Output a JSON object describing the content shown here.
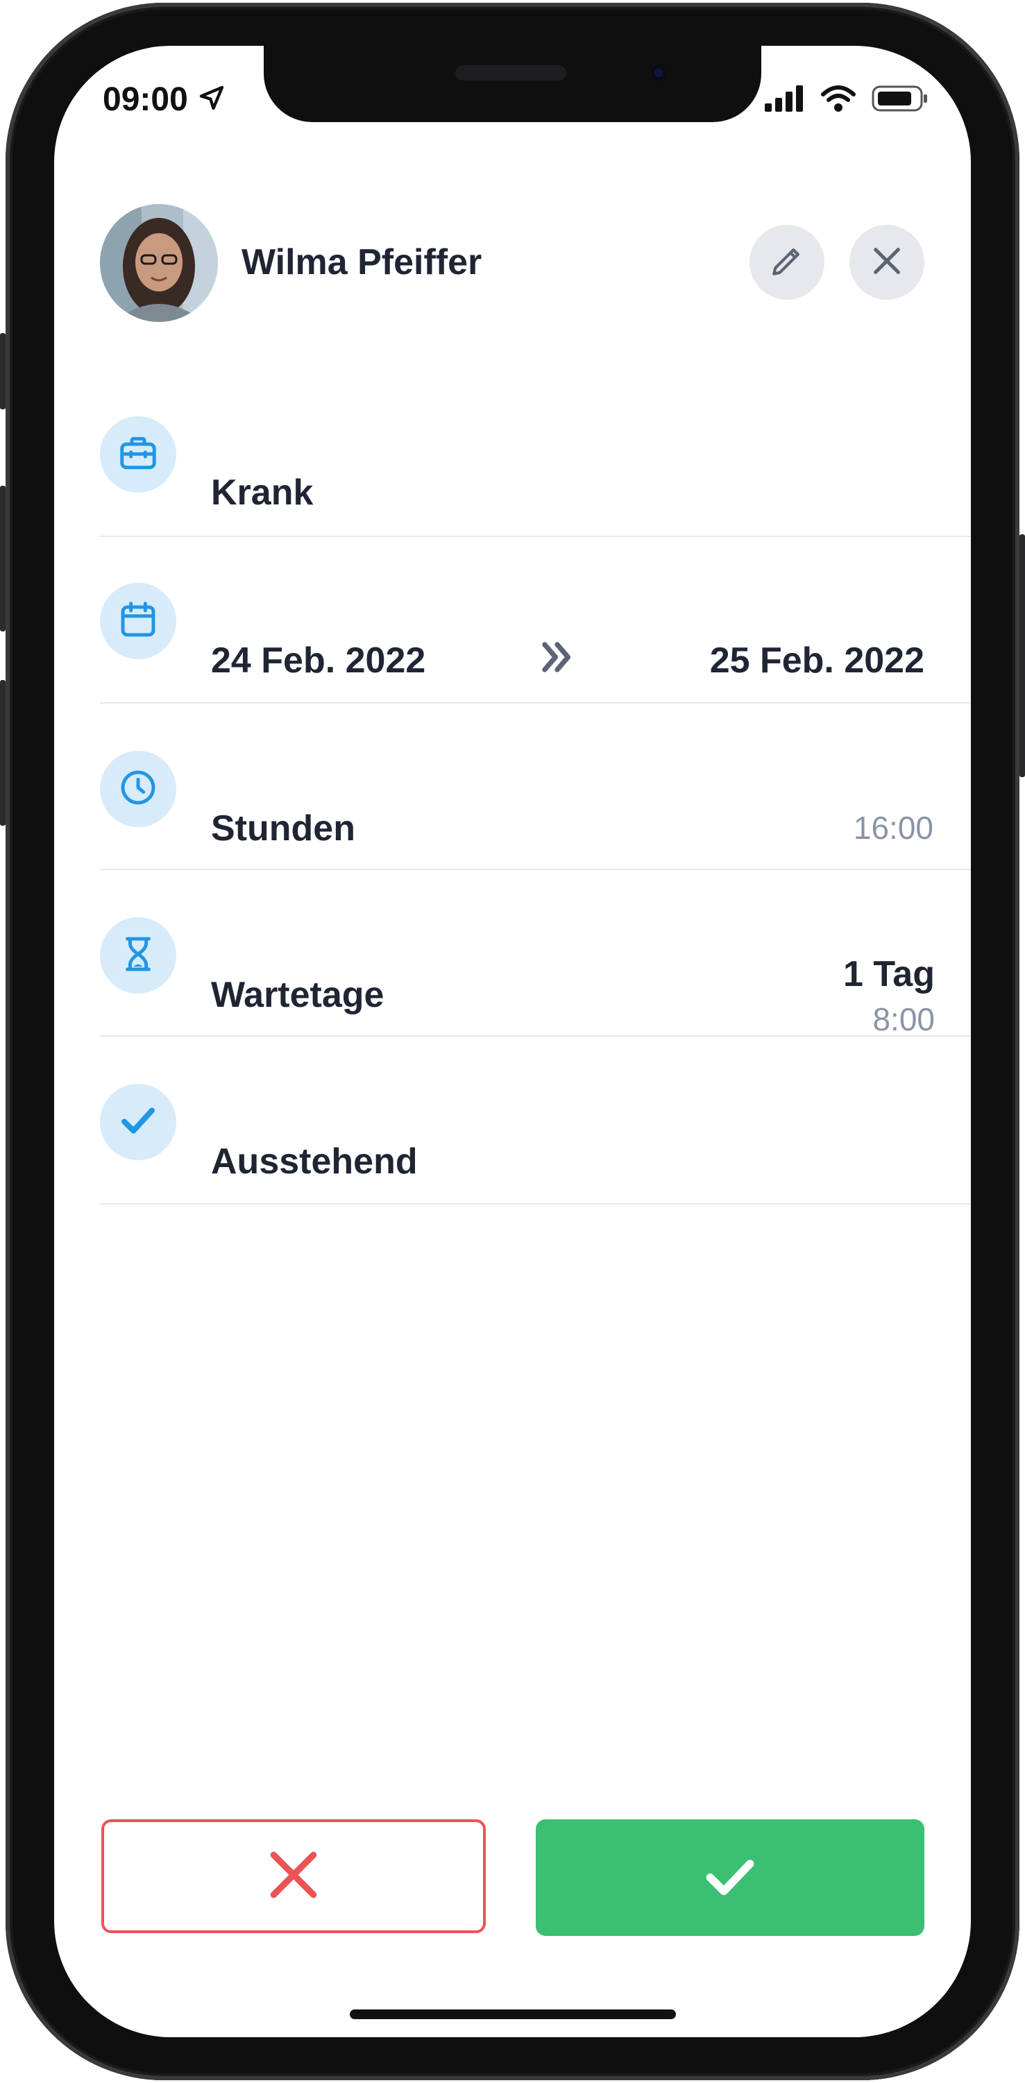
{
  "status_bar": {
    "time": "09:00",
    "icons": [
      "location-arrow-icon",
      "signal-icon",
      "wifi-icon",
      "battery-icon"
    ]
  },
  "header": {
    "name": "Wilma Pfeiffer",
    "edit_icon": "pencil-icon",
    "close_icon": "close-icon"
  },
  "rows": {
    "type": {
      "icon": "briefcase-icon",
      "label": "Krank"
    },
    "dates": {
      "icon": "calendar-icon",
      "start": "24 Feb. 2022",
      "end": "25 Feb. 2022",
      "arrow_icon": "double-chevron-right-icon"
    },
    "hours": {
      "icon": "clock-icon",
      "label": "Stunden",
      "value": "16:00"
    },
    "waiting_days": {
      "icon": "hourglass-icon",
      "label": "Wartetage",
      "value": "1 Tag",
      "subvalue": "8:00"
    },
    "status": {
      "icon": "check-icon",
      "label": "Ausstehend"
    }
  },
  "actions": {
    "reject_icon": "x-icon",
    "approve_icon": "check-icon"
  },
  "colors": {
    "accent_blue": "#2196e3",
    "icon_bg": "#d7ebfa",
    "text_dark": "#1f2533",
    "text_muted": "#8a94a6",
    "reject_red": "#ea5455",
    "approve_green": "#3bbf72"
  }
}
